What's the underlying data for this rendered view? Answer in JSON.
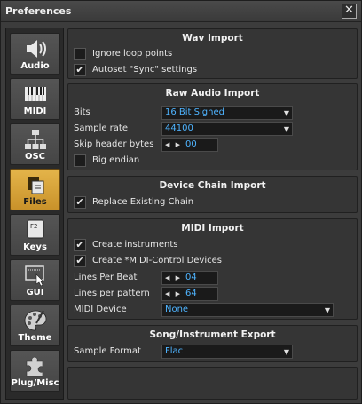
{
  "window": {
    "title": "Preferences",
    "close_glyph": "✕"
  },
  "sidebar": {
    "items": [
      {
        "label": "Audio",
        "icon": "speaker-icon"
      },
      {
        "label": "MIDI",
        "icon": "keyboard-icon"
      },
      {
        "label": "OSC",
        "icon": "network-icon"
      },
      {
        "label": "Files",
        "icon": "files-icon",
        "active": true
      },
      {
        "label": "Keys",
        "icon": "key-icon"
      },
      {
        "label": "GUI",
        "icon": "gui-window-icon"
      },
      {
        "label": "Theme",
        "icon": "palette-icon"
      },
      {
        "label": "Plug/Misc",
        "icon": "puzzle-icon"
      }
    ],
    "accent_color": "#d9a43c"
  },
  "wav_import": {
    "title": "Wav Import",
    "ignore_loop_points": {
      "label": "Ignore loop points",
      "checked": false
    },
    "autoset_sync": {
      "label": "Autoset \"Sync\" settings",
      "checked": true
    }
  },
  "raw_audio_import": {
    "title": "Raw Audio Import",
    "bits": {
      "label": "Bits",
      "value": "16 Bit Signed"
    },
    "sample_rate": {
      "label": "Sample rate",
      "value": "44100"
    },
    "skip_header": {
      "label": "Skip header bytes",
      "value": "00"
    },
    "big_endian": {
      "label": "Big endian",
      "checked": false
    }
  },
  "device_chain_import": {
    "title": "Device Chain Import",
    "replace_existing": {
      "label": "Replace Existing Chain",
      "checked": true
    }
  },
  "midi_import": {
    "title": "MIDI Import",
    "create_instruments": {
      "label": "Create instruments",
      "checked": true
    },
    "create_midi_control": {
      "label": "Create *MIDI-Control Devices",
      "checked": true
    },
    "lines_per_beat": {
      "label": "Lines Per Beat",
      "value": "04"
    },
    "lines_per_pattern": {
      "label": "Lines per pattern",
      "value": "64"
    },
    "midi_device": {
      "label": "MIDI Device",
      "value": "None"
    }
  },
  "song_export": {
    "title": "Song/Instrument Export",
    "sample_format": {
      "label": "Sample Format",
      "value": "Flac"
    }
  },
  "glyphs": {
    "check": "✔",
    "dropdown_arrow": "▼",
    "spin_arrows": "◀ ▶"
  },
  "colors": {
    "value_text": "#4fb4ff",
    "panel_bg": "#353535"
  }
}
